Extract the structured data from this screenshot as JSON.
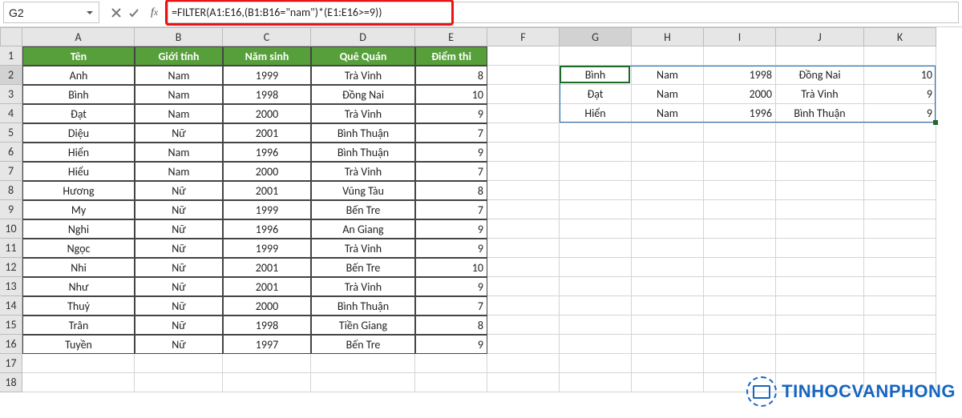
{
  "name_box": "G2",
  "formula": "=FILTER(A1:E16,(B1:B16=\"nam\")*(E1:E16>=9))",
  "columns": [
    "A",
    "B",
    "C",
    "D",
    "E",
    "F",
    "G",
    "H",
    "I",
    "J",
    "K"
  ],
  "row_count": 18,
  "table": {
    "headers": [
      "Tên",
      "Giới tính",
      "Năm sinh",
      "Quê Quán",
      "Điểm thi"
    ],
    "rows": [
      [
        "Anh",
        "Nam",
        "1999",
        "Trà Vinh",
        "8"
      ],
      [
        "Bình",
        "Nam",
        "1998",
        "Đồng Nai",
        "10"
      ],
      [
        "Đạt",
        "Nam",
        "2000",
        "Trà Vinh",
        "9"
      ],
      [
        "Diệu",
        "Nữ",
        "2001",
        "Bình Thuận",
        "7"
      ],
      [
        "Hiển",
        "Nam",
        "1996",
        "Bình Thuận",
        "9"
      ],
      [
        "Hiểu",
        "Nam",
        "2000",
        "Trà Vinh",
        "7"
      ],
      [
        "Hương",
        "Nữ",
        "2001",
        "Vũng Tàu",
        "8"
      ],
      [
        "My",
        "Nữ",
        "1999",
        "Bến Tre",
        "7"
      ],
      [
        "Nghi",
        "Nữ",
        "1996",
        "An Giang",
        "9"
      ],
      [
        "Ngọc",
        "Nữ",
        "1999",
        "Trà Vinh",
        "9"
      ],
      [
        "Nhi",
        "Nữ",
        "2001",
        "Bến Tre",
        "10"
      ],
      [
        "Như",
        "Nữ",
        "2001",
        "Trà Vinh",
        "9"
      ],
      [
        "Thuỷ",
        "Nữ",
        "2000",
        "Bình Thuận",
        "7"
      ],
      [
        "Trân",
        "Nữ",
        "1998",
        "Tiền Giang",
        "8"
      ],
      [
        "Tuyền",
        "Nữ",
        "1997",
        "Bến Tre",
        "9"
      ]
    ]
  },
  "spill": {
    "rows": [
      [
        "Bình",
        "Nam",
        "1998",
        "Đồng Nai",
        "10"
      ],
      [
        "Đạt",
        "Nam",
        "2000",
        "Trà Vinh",
        "9"
      ],
      [
        "Hiển",
        "Nam",
        "1996",
        "Bình Thuận",
        "9"
      ]
    ]
  },
  "watermark": "TINHOCVANPHONG",
  "chart_data": {
    "type": "table",
    "title": "",
    "headers": [
      "Tên",
      "Giới tính",
      "Năm sinh",
      "Quê Quán",
      "Điểm thi"
    ],
    "rows": [
      [
        "Anh",
        "Nam",
        1999,
        "Trà Vinh",
        8
      ],
      [
        "Bình",
        "Nam",
        1998,
        "Đồng Nai",
        10
      ],
      [
        "Đạt",
        "Nam",
        2000,
        "Trà Vinh",
        9
      ],
      [
        "Diệu",
        "Nữ",
        2001,
        "Bình Thuận",
        7
      ],
      [
        "Hiển",
        "Nam",
        1996,
        "Bình Thuận",
        9
      ],
      [
        "Hiểu",
        "Nam",
        2000,
        "Trà Vinh",
        7
      ],
      [
        "Hương",
        "Nữ",
        2001,
        "Vũng Tàu",
        8
      ],
      [
        "My",
        "Nữ",
        1999,
        "Bến Tre",
        7
      ],
      [
        "Nghi",
        "Nữ",
        1996,
        "An Giang",
        9
      ],
      [
        "Ngọc",
        "Nữ",
        1999,
        "Trà Vinh",
        9
      ],
      [
        "Nhi",
        "Nữ",
        2001,
        "Bến Tre",
        10
      ],
      [
        "Như",
        "Nữ",
        2001,
        "Trà Vinh",
        9
      ],
      [
        "Thuỷ",
        "Nữ",
        2000,
        "Bình Thuận",
        7
      ],
      [
        "Trân",
        "Nữ",
        1998,
        "Tiền Giang",
        8
      ],
      [
        "Tuyền",
        "Nữ",
        1997,
        "Bến Tre",
        9
      ]
    ],
    "filter_result_headers": [
      "Tên",
      "Giới tính",
      "Năm sinh",
      "Quê Quán",
      "Điểm thi"
    ],
    "filter_result_rows": [
      [
        "Bình",
        "Nam",
        1998,
        "Đồng Nai",
        10
      ],
      [
        "Đạt",
        "Nam",
        2000,
        "Trà Vinh",
        9
      ],
      [
        "Hiển",
        "Nam",
        1996,
        "Bình Thuận",
        9
      ]
    ],
    "formula": "=FILTER(A1:E16,(B1:B16=\"nam\")*(E1:E16>=9))"
  }
}
